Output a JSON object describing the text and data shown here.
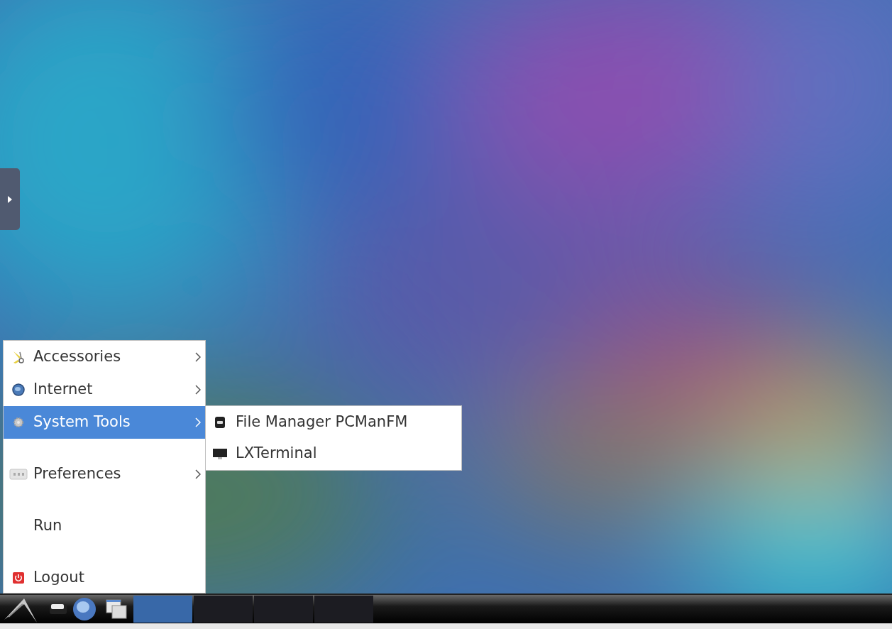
{
  "side_handle": {
    "expanded": false
  },
  "menu": {
    "items": [
      {
        "label": "Accessories",
        "submenu": true,
        "selected": false
      },
      {
        "label": "Internet",
        "submenu": true,
        "selected": false
      },
      {
        "label": "System Tools",
        "submenu": true,
        "selected": true
      },
      {
        "label": "Preferences",
        "submenu": true,
        "selected": false
      },
      {
        "label": "Run",
        "submenu": false,
        "selected": false
      },
      {
        "label": "Logout",
        "submenu": false,
        "selected": false
      }
    ]
  },
  "submenu": {
    "items": [
      {
        "label": "File Manager PCManFM"
      },
      {
        "label": "LXTerminal"
      }
    ]
  },
  "taskbar": {
    "workspaces": [
      {
        "selected": true
      },
      {
        "selected": false
      },
      {
        "selected": false
      },
      {
        "selected": false
      }
    ]
  }
}
